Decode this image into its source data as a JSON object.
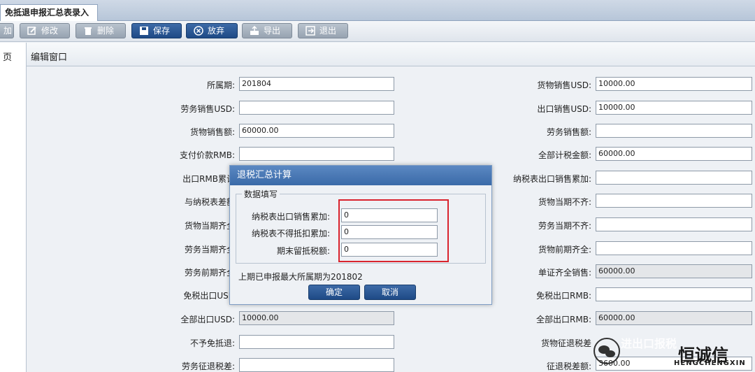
{
  "tab": {
    "title": "免抵退申报汇总表录入"
  },
  "toolbar": {
    "add": "加",
    "edit": "修改",
    "delete": "删除",
    "save": "保存",
    "discard": "放弃",
    "export": "导出",
    "exit": "退出"
  },
  "left": {
    "label": "页"
  },
  "edit_window": {
    "title": "编辑窗口"
  },
  "form_left": [
    {
      "label": "所属期:",
      "value": "201804"
    },
    {
      "label": "劳务销售USD:",
      "value": ""
    },
    {
      "label": "货物销售额:",
      "value": "60000.00"
    },
    {
      "label": "支付价款RMB:",
      "value": ""
    },
    {
      "label": "出口RMB累计",
      "value": ""
    },
    {
      "label": "与纳税表差额",
      "value": ""
    },
    {
      "label": "货物当期齐全",
      "value": ""
    },
    {
      "label": "劳务当期齐全",
      "value": ""
    },
    {
      "label": "劳务前期齐全",
      "value": ""
    },
    {
      "label": "免税出口USD",
      "value": ""
    },
    {
      "label": "全部出口USD:",
      "value": "10000.00"
    },
    {
      "label": "不予免抵退:",
      "value": ""
    },
    {
      "label": "劳务征退税差:",
      "value": ""
    }
  ],
  "form_right": [
    {
      "label": "货物销售USD:",
      "value": "10000.00"
    },
    {
      "label": "出口销售USD:",
      "value": "10000.00"
    },
    {
      "label": "劳务销售额:",
      "value": ""
    },
    {
      "label": "全部计税金额:",
      "value": "60000.00"
    },
    {
      "label": "纳税表出口销售累加:",
      "value": ""
    },
    {
      "label": "货物当期不齐:",
      "value": ""
    },
    {
      "label": "劳务当期不齐:",
      "value": ""
    },
    {
      "label": "货物前期齐全:",
      "value": ""
    },
    {
      "label": "单证齐全销售:",
      "value": "60000.00"
    },
    {
      "label": "免税出口RMB:",
      "value": ""
    },
    {
      "label": "全部出口RMB:",
      "value": "60000.00"
    },
    {
      "label": "货物征退税差",
      "value": ""
    },
    {
      "label": "征退税差额:",
      "value": "3600.00"
    }
  ],
  "modal": {
    "title": "退税汇总计算",
    "legend": "数据填写",
    "fields": [
      {
        "label": "纳税表出口销售累加:",
        "value": "0"
      },
      {
        "label": "纳税表不得抵扣累加:",
        "value": "0"
      },
      {
        "label": "期末留抵税额:",
        "value": "0"
      }
    ],
    "note": "上期已申报最大所属期为201802",
    "ok": "确定",
    "cancel": "取消"
  },
  "watermark": {
    "text1": "进出口报税",
    "text2": "恒诚信",
    "text3": "HENGCHENGXIN"
  }
}
